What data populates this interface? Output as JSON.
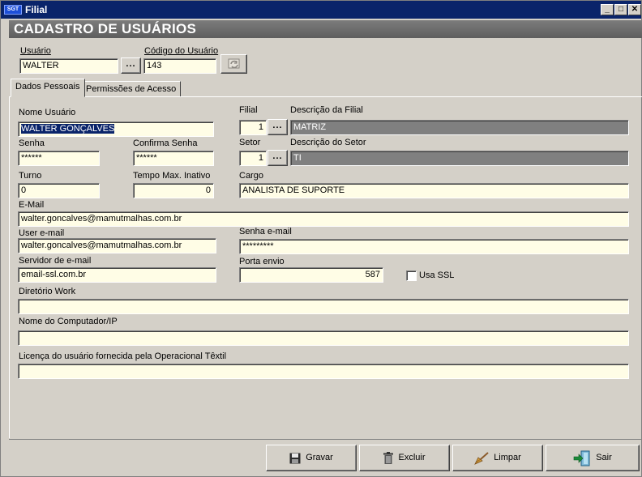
{
  "window": {
    "app_icon": "SGT",
    "title": "Filial",
    "controls": {
      "minimize": "_",
      "maximize": "□",
      "close": "✕"
    }
  },
  "banner": {
    "title": "CADASTRO DE USUÁRIOS"
  },
  "header": {
    "usuario_label": "Usuário",
    "usuario_value": "WALTER",
    "lookup_label": "...",
    "codigo_label": "Código do Usuário",
    "codigo_value": "143"
  },
  "tabs": [
    {
      "label": "Dados Pessoais",
      "active": true
    },
    {
      "label": "Permissões de Acesso",
      "active": false
    }
  ],
  "form": {
    "nome_usuario": {
      "label": "Nome Usuário",
      "value": "WALTER GONÇALVES"
    },
    "filial": {
      "label": "Filial",
      "value": "1"
    },
    "descricao_filial": {
      "label": "Descrição da Filial",
      "value": "MATRIZ"
    },
    "senha": {
      "label": "Senha",
      "value": "******"
    },
    "confirma_senha": {
      "label": "Confirma Senha",
      "value": "******"
    },
    "setor": {
      "label": "Setor",
      "value": "1"
    },
    "descricao_setor": {
      "label": "Descrição do Setor",
      "value": "TI"
    },
    "turno": {
      "label": "Turno",
      "value": "0"
    },
    "tempo_max_inativo": {
      "label": "Tempo Max. Inativo",
      "value": "0"
    },
    "cargo": {
      "label": "Cargo",
      "value": "ANALISTA DE SUPORTE"
    },
    "email": {
      "label": "E-Mail",
      "value": "walter.goncalves@mamutmalhas.com.br"
    },
    "user_email": {
      "label": "User e-mail",
      "value": "walter.goncalves@mamutmalhas.com.br"
    },
    "senha_email": {
      "label": "Senha e-mail",
      "value": "*********"
    },
    "servidor_email": {
      "label": "Servidor de e-mail",
      "value": "email-ssl.com.br"
    },
    "porta_envio": {
      "label": "Porta envio",
      "value": "587"
    },
    "usa_ssl": {
      "label": "Usa SSL",
      "checked": false
    },
    "diretorio_work": {
      "label": "Diretório Work",
      "value": ""
    },
    "nome_computador": {
      "label": "Nome do Computador/IP",
      "value": ""
    },
    "licenca": {
      "label": "Licença do usuário fornecida pela Operacional Têxtil",
      "value": ""
    }
  },
  "footer": {
    "gravar": "Gravar",
    "excluir": "Excluir",
    "limpar": "Limpar",
    "sair": "Sair"
  },
  "colors": {
    "titlebar": "#0a246a",
    "banner": "#6e6e6e",
    "field_bg": "#fffde6",
    "disabled_field": "#808080",
    "face": "#d4d0c8"
  },
  "icons": {
    "refresh": "refresh-icon",
    "gravar": "floppy-disk-icon",
    "excluir": "trash-can-icon",
    "limpar": "broom-icon",
    "sair": "exit-door-icon"
  }
}
